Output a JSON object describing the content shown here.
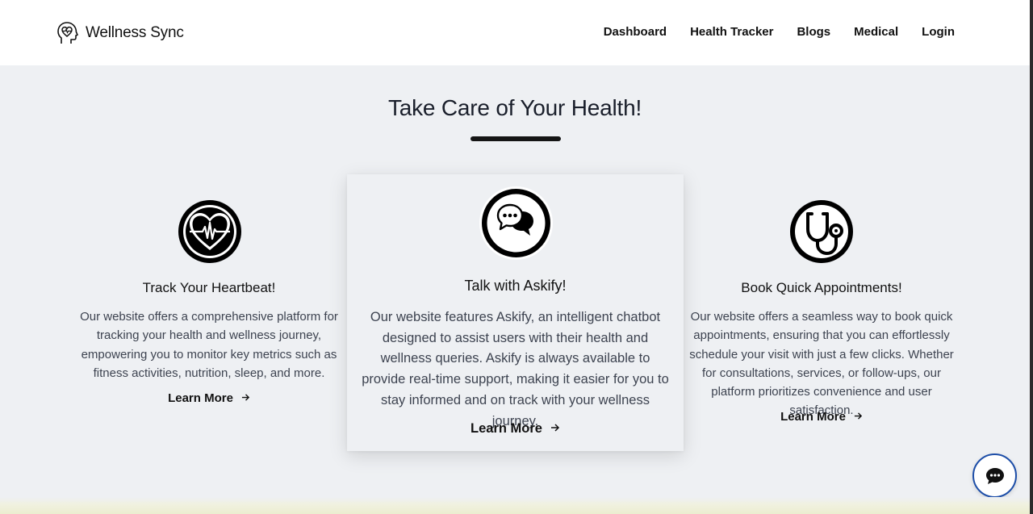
{
  "header": {
    "brand_name": "Wellness Sync",
    "brand_icon": "head-heart-icon",
    "nav": [
      "Dashboard",
      "Health Tracker",
      "Blogs",
      "Medical",
      "Login"
    ]
  },
  "section": {
    "title": "Take Care of Your Health!"
  },
  "cards": [
    {
      "icon": "heartbeat-icon",
      "title": "Track Your Heartbeat!",
      "text": "Our website offers a comprehensive platform for tracking your health and wellness journey, empowering you to monitor key metrics such as fitness activities, nutrition, sleep, and more.",
      "link": "Learn More"
    },
    {
      "icon": "chat-bubbles-icon",
      "title": "Talk with Askify!",
      "text": "Our website features Askify, an intelligent chatbot designed to assist users with their health and wellness queries. Askify is always available to provide real-time support, making it easier for you to stay informed and on track with your wellness journey.",
      "link": "Learn More"
    },
    {
      "icon": "stethoscope-icon",
      "title": "Book Quick Appointments!",
      "text": "Our website offers a seamless way to book quick appointments, ensuring that you can effortlessly schedule your visit with just a few clicks. Whether for consultations, services, or follow-ups, our platform prioritizes convenience and user satisfaction.",
      "link": "Learn More"
    }
  ],
  "chat_button": {
    "icon": "chat-icon"
  },
  "colors": {
    "accent": "#1d4ea8",
    "background": "#eef0f3",
    "text": "#1a1f2b"
  }
}
